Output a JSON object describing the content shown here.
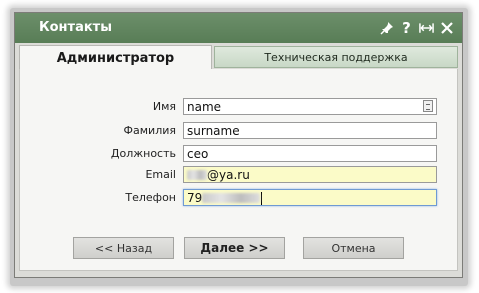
{
  "window": {
    "title": "Контакты"
  },
  "titlebar_icons": [
    "pin-icon",
    "help-icon",
    "resize-icon",
    "close-icon"
  ],
  "titlebar_help_glyph": "?",
  "tabs": [
    {
      "label": "Администратор",
      "active": true
    },
    {
      "label": "Техническая поддержка",
      "active": false
    }
  ],
  "form": {
    "name": {
      "label": "Имя",
      "value": "name"
    },
    "surname": {
      "label": "Фамилия",
      "value": "surname"
    },
    "position": {
      "label": "Должность",
      "value": "ceo"
    },
    "email": {
      "label": "Email",
      "value_visible": "@ya.ru"
    },
    "phone": {
      "label": "Телефон",
      "value_visible": "79"
    }
  },
  "buttons": {
    "back": "<< Назад",
    "next": "Далее >>",
    "cancel": "Отмена"
  },
  "colors": {
    "titlebar": "#608660",
    "autofill_yellow": "#fbfbc8",
    "focus_border": "#6f9ad3"
  }
}
